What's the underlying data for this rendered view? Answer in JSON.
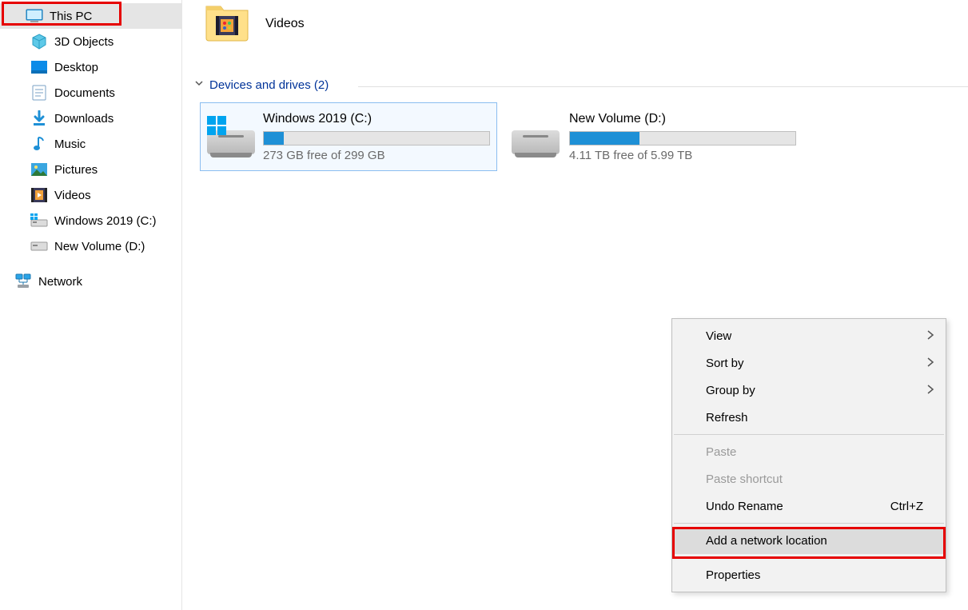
{
  "sidebar": {
    "selected": "This PC",
    "items": [
      {
        "label": "This PC",
        "icon": "thispc"
      },
      {
        "label": "3D Objects",
        "icon": "3d"
      },
      {
        "label": "Desktop",
        "icon": "desktop"
      },
      {
        "label": "Documents",
        "icon": "documents"
      },
      {
        "label": "Downloads",
        "icon": "downloads"
      },
      {
        "label": "Music",
        "icon": "music"
      },
      {
        "label": "Pictures",
        "icon": "pictures"
      },
      {
        "label": "Videos",
        "icon": "videos"
      },
      {
        "label": "Windows 2019 (C:)",
        "icon": "drive-c"
      },
      {
        "label": "New Volume (D:)",
        "icon": "drive-d"
      }
    ],
    "network": "Network"
  },
  "folder_tile": {
    "name": "Videos"
  },
  "group_header": "Devices and drives (2)",
  "drives": [
    {
      "name": "Windows 2019 (C:)",
      "free_text": "273 GB free of 299 GB",
      "fill_percent": 9,
      "os_badge": true,
      "selected": true
    },
    {
      "name": "New Volume (D:)",
      "free_text": "4.11 TB free of 5.99 TB",
      "fill_percent": 31,
      "os_badge": false,
      "selected": false
    }
  ],
  "context_menu": {
    "view": "View",
    "sort_by": "Sort by",
    "group_by": "Group by",
    "refresh": "Refresh",
    "paste": "Paste",
    "paste_shortcut": "Paste shortcut",
    "undo_rename": "Undo Rename",
    "undo_shortcut": "Ctrl+Z",
    "add_network": "Add a network location",
    "properties": "Properties"
  }
}
